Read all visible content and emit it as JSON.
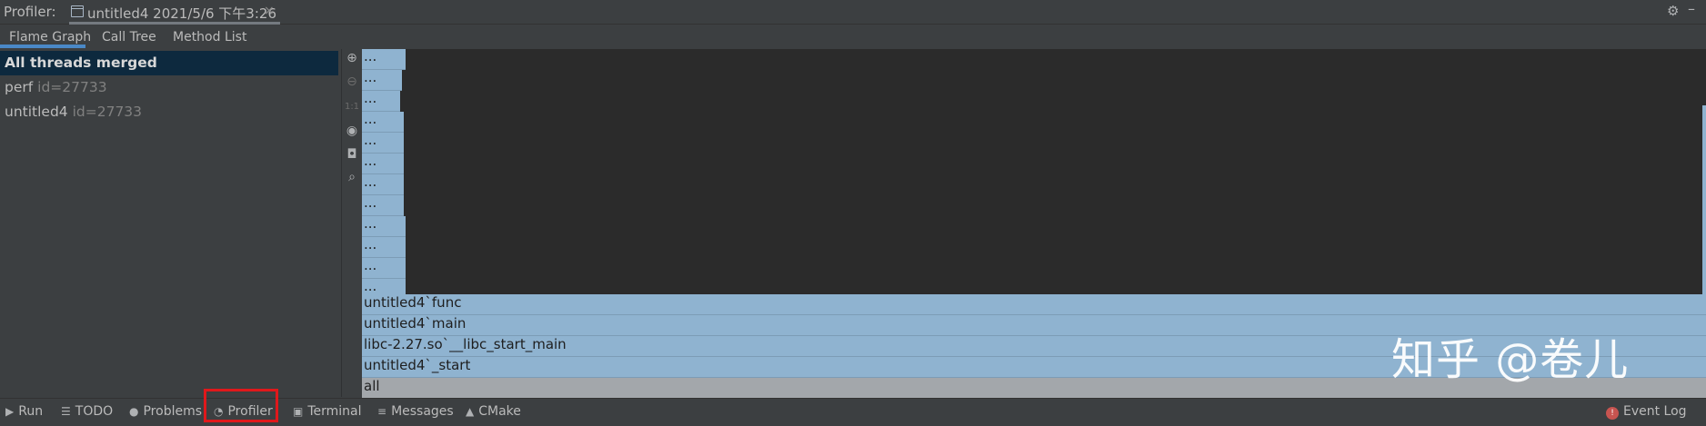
{
  "header": {
    "profiler_label": "Profiler:",
    "session_title": "untitled4 2021/5/6 下午3:26",
    "close_glyph": "×"
  },
  "subtabs": [
    "Flame Graph",
    "Call Tree",
    "Method List"
  ],
  "threads": [
    {
      "name": "All threads merged",
      "id": ""
    },
    {
      "name": "perf",
      "id": "id=27733"
    },
    {
      "name": "untitled4",
      "id": "id=27733"
    }
  ],
  "toolbar_icons": [
    "zoom-in-icon",
    "zoom-out-icon",
    "reset-zoom-icon",
    "eye-icon",
    "camera-icon",
    "search-icon"
  ],
  "toolbar_reset_label": "1:1",
  "flame": {
    "dots_label": "...",
    "frames": [
      "untitled4`func",
      "untitled4`main",
      "libc-2.27.so`__libc_start_main",
      "untitled4`_start",
      "all"
    ]
  },
  "watermark": "知乎 @卷儿",
  "bottom_tabs": {
    "run": "Run",
    "todo": "TODO",
    "problems": "Problems",
    "profiler": "Profiler",
    "terminal": "Terminal",
    "messages": "Messages",
    "cmake": "CMake",
    "event_log": "Event Log"
  },
  "colors": {
    "frame_blue": "#8fb3d0",
    "frame_root": "#a3a7ab",
    "selected_thread": "#0d293e",
    "highlight_box": "#e0181b"
  }
}
